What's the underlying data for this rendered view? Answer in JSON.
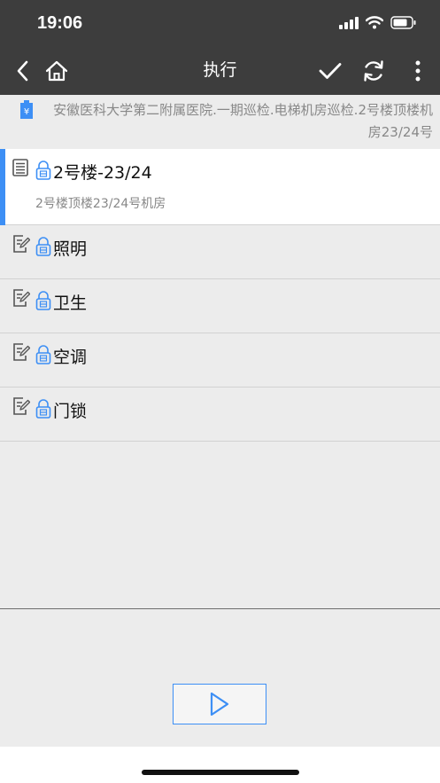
{
  "status_bar": {
    "time": "19:06"
  },
  "nav": {
    "title": "执行"
  },
  "path": {
    "text": "安徽医科大学第二附属医院.一期巡检.电梯机房巡检.2号楼顶楼机房23/24号"
  },
  "items": [
    {
      "title": "2号楼-23/24",
      "subtitle": "2号楼顶楼23/24号机房",
      "selected": true
    },
    {
      "title": "照明"
    },
    {
      "title": "卫生"
    },
    {
      "title": "空调"
    },
    {
      "title": "门锁"
    }
  ],
  "colors": {
    "accent": "#3d8ff5",
    "dark_bar": "#3d3d3d",
    "background": "#ececec"
  }
}
